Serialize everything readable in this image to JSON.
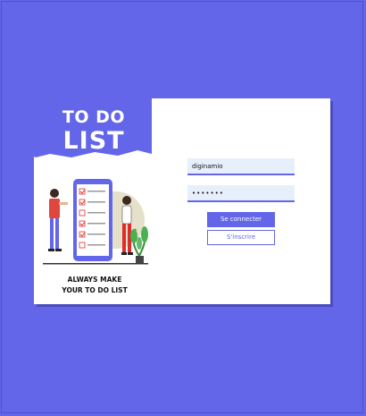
{
  "brand": {
    "title_line1": "TO DO",
    "title_line2": "LIST",
    "tagline_line1": "ALWAYS MAKE",
    "tagline_line2": "YOUR TO DO LIST"
  },
  "login": {
    "username_value": "diginamio",
    "password_value": "•••••••",
    "login_label": "Se connecter",
    "register_label": "S'inscrire"
  },
  "colors": {
    "background": "#6366e8",
    "accent": "#6366e8",
    "field_bg": "#e8effc",
    "card": "#ffffff"
  },
  "icons": [
    "checklist-phone-illustration",
    "man-figure",
    "woman-figure",
    "plant-icon"
  ]
}
